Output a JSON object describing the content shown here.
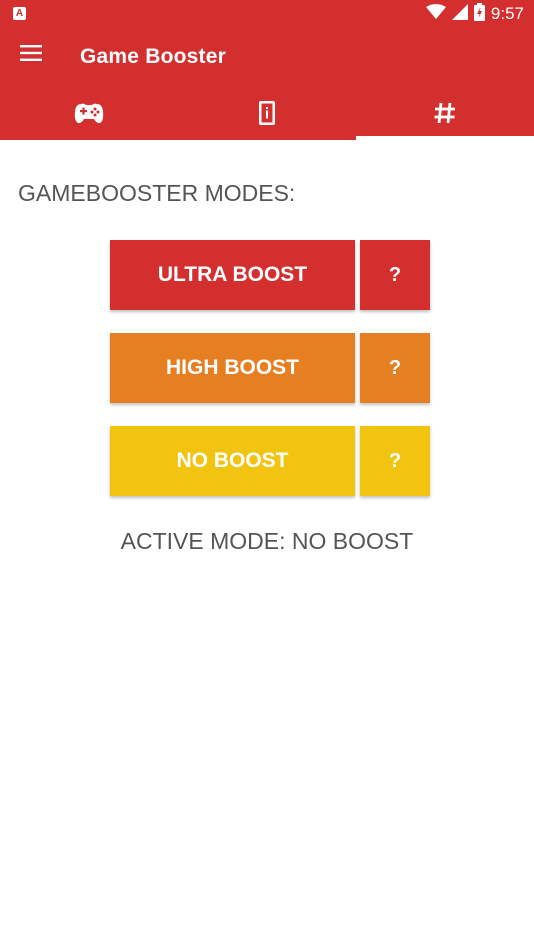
{
  "status_bar": {
    "left_badge": "A",
    "time": "9:57",
    "icons": [
      "wifi-icon",
      "signal-icon",
      "battery-icon"
    ]
  },
  "app": {
    "title": "Game Booster",
    "menu_icon": "hamburger-menu-icon",
    "accent": "#D32F2F"
  },
  "tabs": [
    {
      "icon": "gamepad-icon",
      "selected": false
    },
    {
      "icon": "phone-info-icon",
      "selected": false
    },
    {
      "icon": "hashtag-icon",
      "selected": true
    }
  ],
  "main": {
    "section_label": "GAMEBOOSTER MODES:",
    "modes": [
      {
        "label": "ULTRA BOOST",
        "help": "?",
        "color": "#D32F2F"
      },
      {
        "label": "HIGH BOOST",
        "help": "?",
        "color": "#E67E22"
      },
      {
        "label": "NO BOOST",
        "help": "?",
        "color": "#F1C40F"
      }
    ],
    "active_mode": "ACTIVE MODE: NO BOOST"
  }
}
